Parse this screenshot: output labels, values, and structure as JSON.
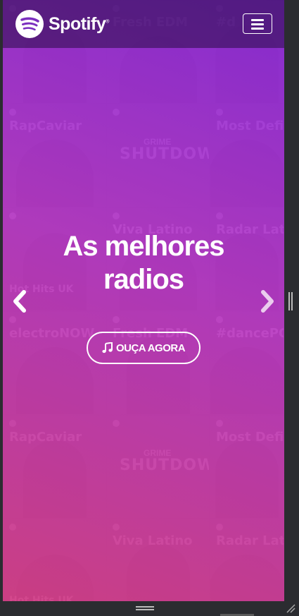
{
  "brand": {
    "name": "Spotify",
    "trademark": "®",
    "logo_icon": "spotify-logo-icon"
  },
  "navbar": {
    "menu_icon": "hamburger-menu-icon"
  },
  "hero": {
    "title_line1": "As melhores",
    "title_line2": "radios",
    "cta_label": "OUÇA AGORA",
    "cta_icon": "music-note-icon"
  },
  "carousel": {
    "prev_icon": "chevron-left-icon",
    "next_icon": "chevron-right-icon"
  },
  "background_tiles": [
    {
      "title": "",
      "pos": "top"
    },
    {
      "title": "Fresh EDM",
      "pos": "top"
    },
    {
      "title": "#d",
      "pos": "top"
    },
    {
      "title": "RapCaviar",
      "pos": "top"
    },
    {
      "title": "SHUTDOWN",
      "sub": "GRIME",
      "pos": "shutdown"
    },
    {
      "title": "Most DefiL",
      "pos": "top"
    },
    {
      "title": "Hot Hits UK",
      "pos": "bottom"
    },
    {
      "title": "Viva Latino",
      "pos": "top"
    },
    {
      "title": "Radar Lati",
      "pos": "top"
    },
    {
      "title": "electroNOW",
      "pos": "top"
    },
    {
      "title": "Fresh EDM",
      "pos": "top"
    },
    {
      "title": "#dancePO",
      "pos": "top"
    },
    {
      "title": "RapCaviar",
      "pos": "top"
    },
    {
      "title": "SHUTDOWN",
      "sub": "GRIME",
      "pos": "shutdown"
    },
    {
      "title": "Most DefiL",
      "pos": "top"
    },
    {
      "title": "Hot Hits UK",
      "pos": "bottom"
    },
    {
      "title": "Viva Latino",
      "pos": "top"
    },
    {
      "title": "Radar Lati",
      "pos": "top"
    }
  ],
  "colors": {
    "overlay_top": "#9a2de6",
    "overlay_bottom": "#dc418c",
    "window_frame": "#2b2c30"
  }
}
